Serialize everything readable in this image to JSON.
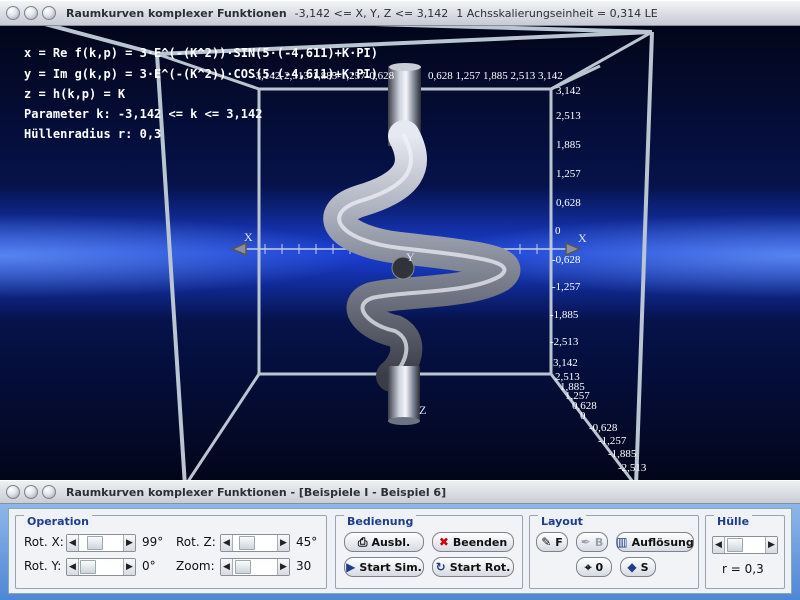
{
  "window_top": {
    "title": "Raumkurven komplexer Funktionen",
    "range": "-3,142 <= X, Y, Z <= 3,142",
    "scale": "1 Achsskalierungseinheit = 0,314 LE"
  },
  "info": {
    "line1": "x = Re f(k,p) = 3·E^(-(K^2))·SIN(5·(-4,611)+K·PI)",
    "line2": "y = Im g(k,p) = 3·E^(-(K^2))·COS(5·(-4,611)+K·PI)",
    "line3": "z = h(k,p) = K",
    "line4": "Parameter k: -3,142 <= k <= 3,142",
    "line5": "Hüllenradius r: 0,3"
  },
  "axes": {
    "x_label_left": "X",
    "x_label_right": "X",
    "y_label": "Y",
    "z_label": "Z",
    "top_ticks": "-3,142-2,513-1,885-1,257-0,628",
    "top_ticks_right": "0,628 1,257 1,885 2,513 3,142",
    "right_ticks": [
      "3,142",
      "2,513",
      "1,885",
      "1,257",
      "0,628",
      "0",
      "-0,628",
      "-1,257",
      "-1,885",
      "-2,513"
    ],
    "corner_ticks": [
      "3,142",
      "2,513",
      "1,885",
      "1,257",
      "0,628",
      "0",
      "-0,628",
      "-1,257",
      "-1,885",
      "-2,513"
    ]
  },
  "window_bottom": {
    "title": "Raumkurven komplexer Funktionen - [Beispiele I - Beispiel 6]"
  },
  "operation": {
    "title": "Operation",
    "rot_x_label": "Rot. X:",
    "rot_x_value": "99°",
    "rot_y_label": "Rot. Y:",
    "rot_y_value": "0°",
    "rot_z_label": "Rot. Z:",
    "rot_z_value": "45°",
    "zoom_label": "Zoom:",
    "zoom_value": "30"
  },
  "bedienung": {
    "title": "Bedienung",
    "ausbl": "Ausbl.",
    "beenden": "Beenden",
    "start_sim": "Start Sim.",
    "start_rot": "Start Rot."
  },
  "layout": {
    "title": "Layout",
    "btn_f": "F",
    "btn_b": "B",
    "aufloesung": "Auflösung",
    "btn_0": "0",
    "btn_s": "S"
  },
  "huelle": {
    "title": "Hülle",
    "value": "r = 0,3"
  },
  "colors": {
    "accent": "#1f3d8a",
    "scene_center": "#1a3fd6",
    "scene_dark": "#02061a"
  }
}
